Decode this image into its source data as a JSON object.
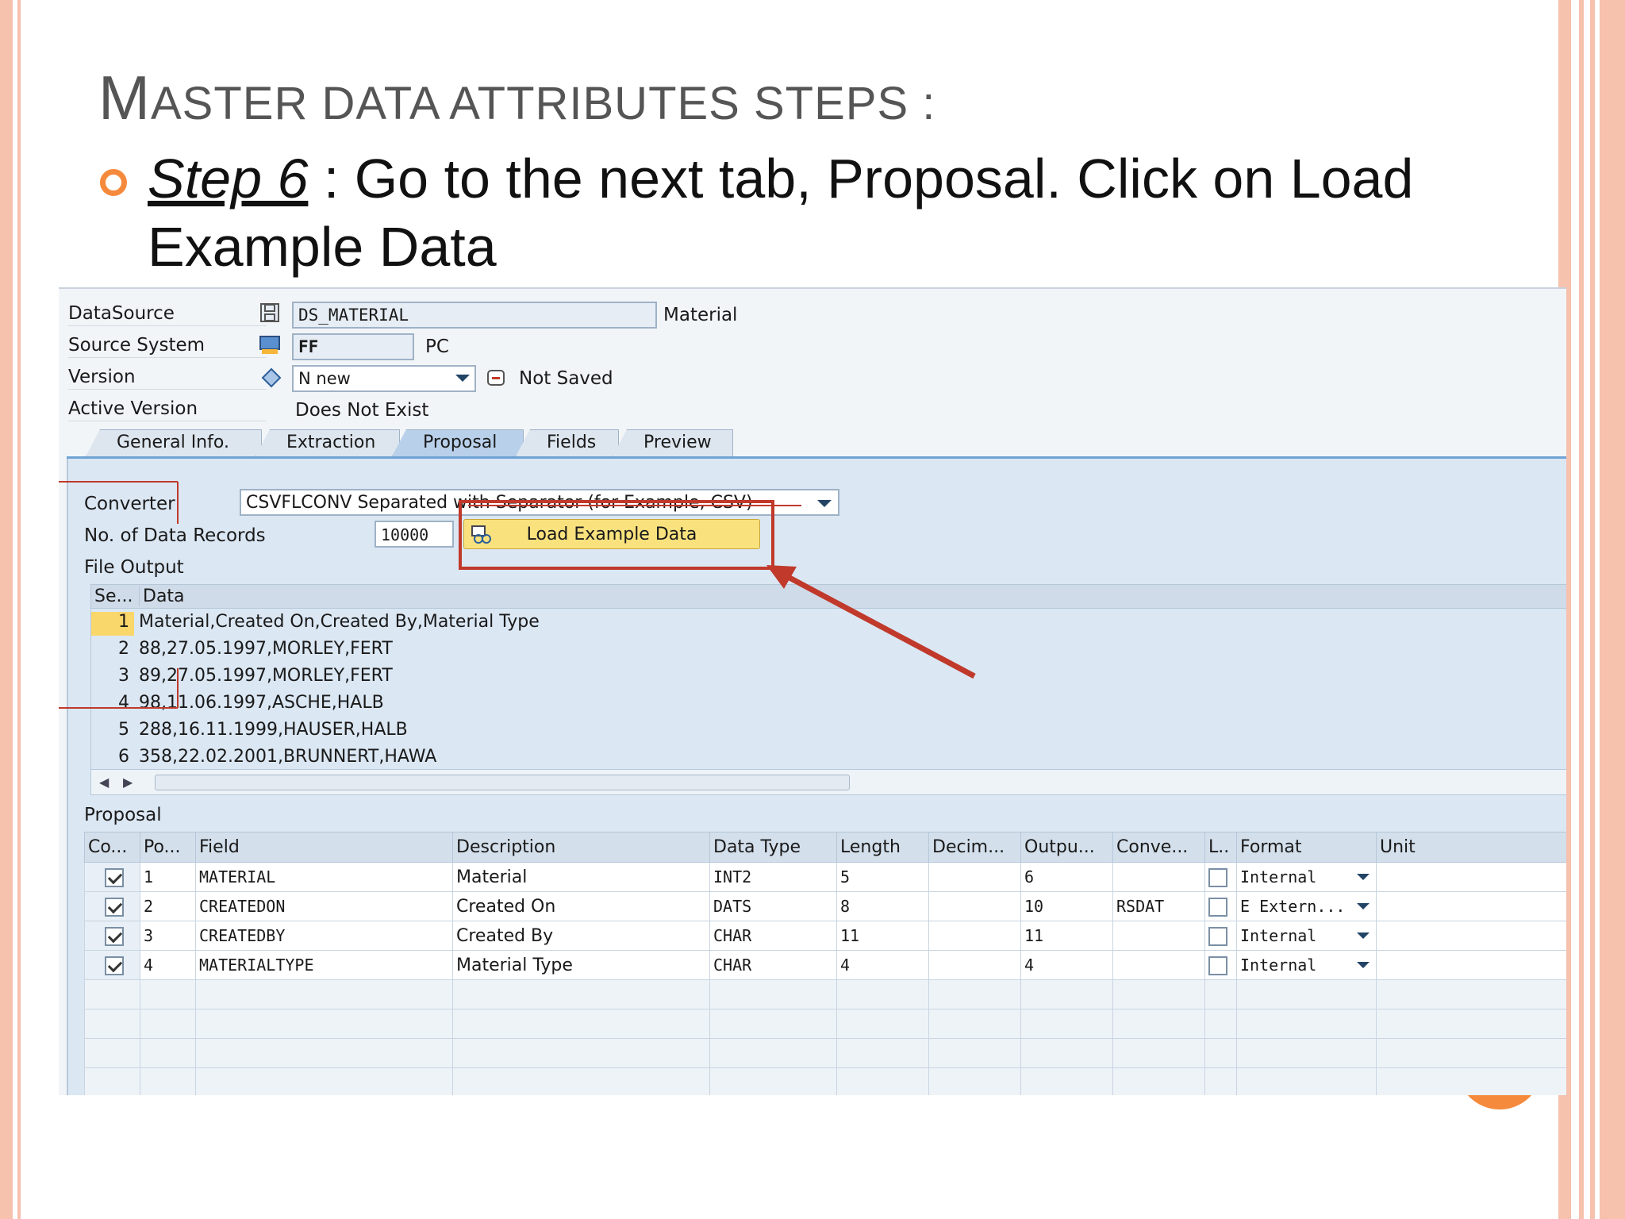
{
  "slide": {
    "title_first": "M",
    "title_rest": "ASTER DATA ATTRIBUTES STEPS :",
    "step_label": "Step 6",
    "step_text": " : Go to the next tab, Proposal. Click on Load Example Data"
  },
  "header": {
    "datasource_label": "DataSource",
    "datasource_value": "DS_MATERIAL",
    "datasource_desc": "Material",
    "source_system_label": "Source System",
    "source_system_value": "FF",
    "source_system_desc": "PC",
    "version_label": "Version",
    "version_value": "N new",
    "version_status": "Not Saved",
    "active_version_label": "Active Version",
    "active_version_value": "Does Not Exist"
  },
  "tabs": [
    {
      "label": "General Info."
    },
    {
      "label": "Extraction"
    },
    {
      "label": "Proposal",
      "active": true
    },
    {
      "label": "Fields"
    },
    {
      "label": "Preview"
    }
  ],
  "proposal_tab": {
    "converter_label": "Converter",
    "converter_value": "CSVFLCONV Separated with Separator (for Example, CSV)",
    "records_label": "No. of Data Records",
    "records_value": "10000",
    "load_button": "Load Example Data",
    "file_output_label": "File Output",
    "grid_headers": [
      "Se...",
      "Data"
    ],
    "grid_rows": [
      {
        "no": "1",
        "data": "Material,Created On,Created By,Material Type"
      },
      {
        "no": "2",
        "data": "88,27.05.1997,MORLEY,FERT"
      },
      {
        "no": "3",
        "data": "89,27.05.1997,MORLEY,FERT"
      },
      {
        "no": "4",
        "data": "98,11.06.1997,ASCHE,HALB"
      },
      {
        "no": "5",
        "data": "288,16.11.1999,HAUSER,HALB"
      },
      {
        "no": "6",
        "data": "358,22.02.2001,BRUNNERT,HAWA"
      }
    ],
    "proposal_label": "Proposal",
    "table_headers": [
      "Co...",
      "Po...",
      "Field",
      "Description",
      "Data Type",
      "Length",
      "Decim...",
      "Outpu...",
      "Conve...",
      "L..",
      "Format",
      "Unit"
    ],
    "table_rows": [
      {
        "pos": "1",
        "field": "MATERIAL",
        "desc": "Material",
        "type": "INT2",
        "length": "5",
        "decim": "",
        "output": "6",
        "conv": "",
        "format": "Internal"
      },
      {
        "pos": "2",
        "field": "CREATEDON",
        "desc": "Created On",
        "type": "DATS",
        "length": "8",
        "decim": "",
        "output": "10",
        "conv": "RSDAT",
        "format": "E  Extern..."
      },
      {
        "pos": "3",
        "field": "CREATEDBY",
        "desc": "Created By",
        "type": "CHAR",
        "length": "11",
        "decim": "",
        "output": "11",
        "conv": "",
        "format": "Internal"
      },
      {
        "pos": "4",
        "field": "MATERIALTYPE",
        "desc": "Material Type",
        "type": "CHAR",
        "length": "4",
        "decim": "",
        "output": "4",
        "conv": "",
        "format": "Internal"
      }
    ]
  },
  "colors": {
    "accent": "#f58a3c",
    "frame": "#f6c1ad",
    "highlight": "#c0392b",
    "button": "#f9e27e"
  }
}
